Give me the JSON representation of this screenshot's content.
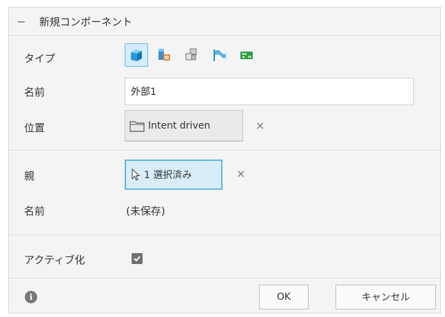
{
  "header": {
    "collapse_symbol": "−",
    "title": "新規コンポーネント"
  },
  "type_row": {
    "label": "タイプ",
    "options": [
      {
        "icon": "blue-cube-icon",
        "selected": true
      },
      {
        "icon": "part-with-badge-icon",
        "selected": false
      },
      {
        "icon": "assembly-blocks-icon",
        "selected": false
      },
      {
        "icon": "sheet-metal-flag-icon",
        "selected": false
      },
      {
        "icon": "green-pcb-icon",
        "selected": false
      }
    ]
  },
  "name_row": {
    "label": "名前",
    "value": "外部1"
  },
  "location_row": {
    "label": "位置",
    "button_label": "Intent driven",
    "icon": "folder-icon",
    "clear": "×"
  },
  "parent_row": {
    "label": "親",
    "button_label": "1 選択済み",
    "icon": "cursor-arrow-icon",
    "clear": "×"
  },
  "parent_name_row": {
    "label": "名前",
    "value": "(未保存)"
  },
  "activate_row": {
    "label": "アクティブ化",
    "checked": true
  },
  "footer": {
    "info": "i",
    "ok_label": "OK",
    "cancel_label": "キャンセル"
  },
  "colors": {
    "selection_blue": "#5db6e6",
    "selection_fill": "#d8edf9",
    "panel_bg": "#f4f4f4"
  }
}
